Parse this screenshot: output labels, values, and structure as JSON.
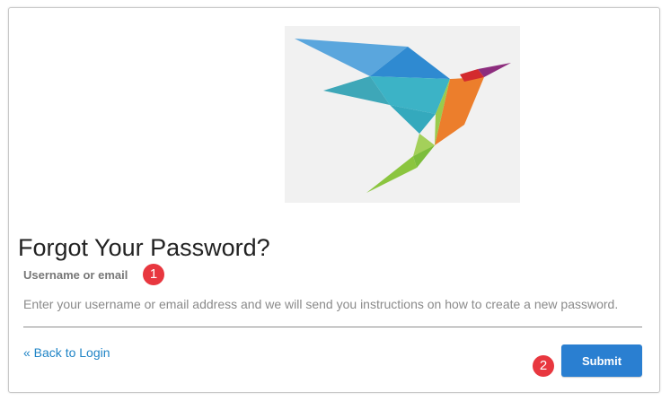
{
  "logo": {
    "icon": "hummingbird-logo-icon"
  },
  "page": {
    "title": "Forgot Your Password?"
  },
  "form": {
    "field_label": "Username or email",
    "field_value": "",
    "help_text": "Enter your username or email address and we will send you instructions on how to create a new password.",
    "back_link": "« Back to Login",
    "submit_label": "Submit"
  },
  "markers": {
    "one": "1",
    "two": "2"
  },
  "colors": {
    "accent": "#2a7fd1",
    "link": "#1f84c6",
    "marker": "#e8373f"
  }
}
